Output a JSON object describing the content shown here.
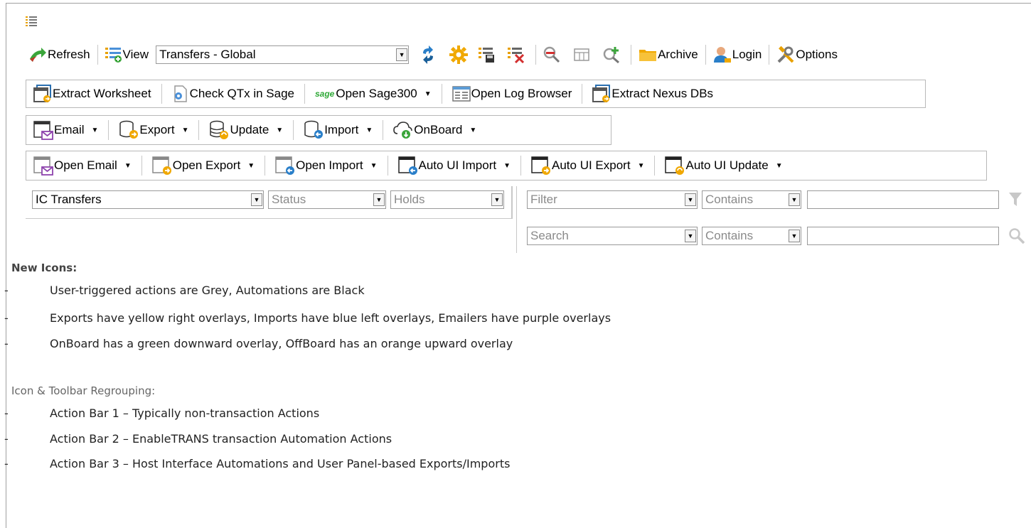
{
  "toolbar": {
    "refresh_label": "Refresh",
    "view_label": "View",
    "view_select": "Transfers - Global",
    "archive_label": "Archive",
    "login_label": "Login",
    "options_label": "Options"
  },
  "action_bar_1": {
    "extract_worksheet": "Extract Worksheet",
    "check_qtx": "Check QTx in Sage",
    "sage_logo": "sage",
    "open_sage300": "Open Sage300",
    "open_log_browser": "Open Log Browser",
    "extract_nexus": "Extract Nexus DBs"
  },
  "action_bar_2": {
    "email": "Email",
    "export": "Export",
    "update": "Update",
    "import": "Import",
    "onboard": "OnBoard"
  },
  "action_bar_3": {
    "open_email": "Open Email",
    "open_export": "Open Export",
    "open_import": "Open Import",
    "auto_ui_import": "Auto UI Import",
    "auto_ui_export": "Auto UI Export",
    "auto_ui_update": "Auto UI Update"
  },
  "filters": {
    "list_select": "IC Transfers",
    "status_placeholder": "Status",
    "holds_placeholder": "Holds",
    "filter_field": "Filter",
    "filter_op": "Contains",
    "search_field": "Search",
    "search_op": "Contains"
  },
  "notes": {
    "heading": "New Icons:",
    "items": [
      "User-triggered actions are Grey, Automations are Black",
      "Exports have yellow right overlays, Imports have blue left overlays, Emailers have purple overlays",
      "OnBoard has a green downward overlay, OffBoard has an orange upward overlay"
    ],
    "heading2": "Icon & Toolbar Regrouping:",
    "items2": [
      "Action Bar 1 – Typically non-transaction Actions",
      "Action Bar 2 – EnableTRANS transaction Automation Actions",
      "Action Bar 3 – Host Interface Automations and User Panel-based Exports/Imports"
    ],
    "dash": "-"
  }
}
